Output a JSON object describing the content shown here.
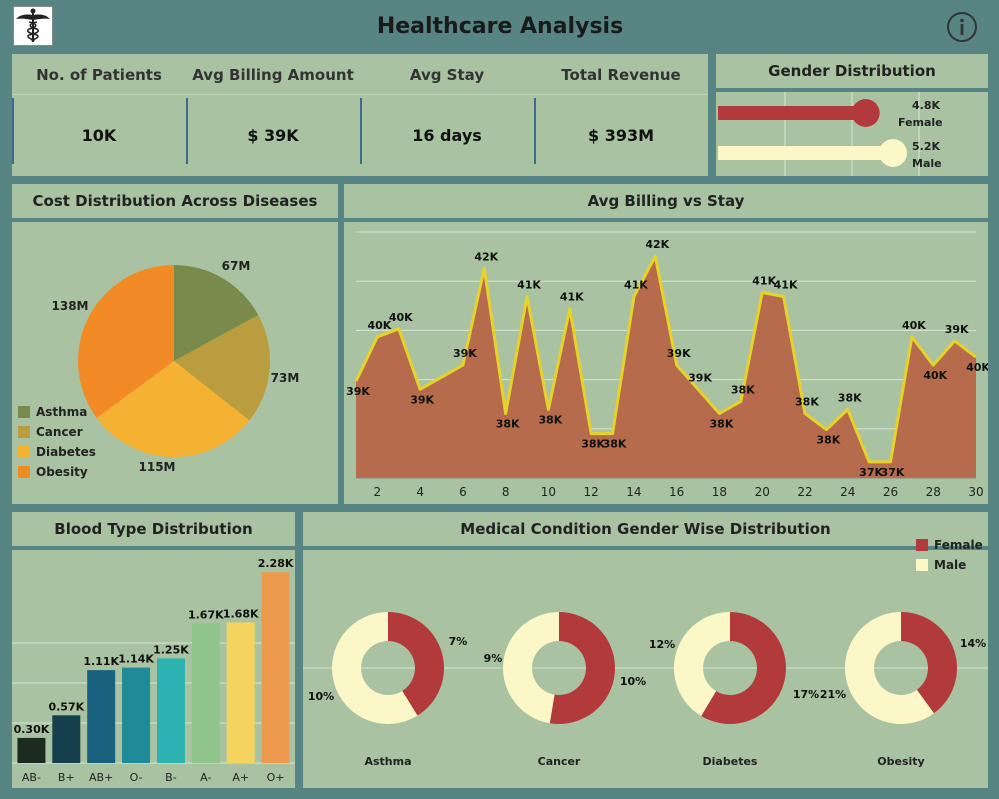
{
  "header": {
    "title": "Healthcare Analysis",
    "logo_icon": "caduceus-icon",
    "info_icon": "info-icon"
  },
  "kpis": [
    {
      "label": "No. of Patients",
      "value": "10K"
    },
    {
      "label": "Avg Billing Amount",
      "value": "$ 39K"
    },
    {
      "label": "Avg Stay",
      "value": "16 days"
    },
    {
      "label": "Total Revenue",
      "value": "$ 393M"
    }
  ],
  "gender": {
    "title": "Gender Distribution",
    "female": {
      "value_label": "4.8K",
      "name": "Female",
      "value": 4.8,
      "color": "#b23a3a"
    },
    "male": {
      "value_label": "5.2K",
      "name": "Male",
      "value": 5.2,
      "color": "#fbf7c6"
    }
  },
  "cost": {
    "title": "Cost Distribution Across Diseases",
    "legend": [
      "Asthma",
      "Cancer",
      "Diabetes",
      "Obesity"
    ]
  },
  "billing": {
    "title": "Avg Billing vs Stay"
  },
  "blood": {
    "title": "Blood Type Distribution"
  },
  "medical": {
    "title": "Medical Condition Gender Wise Distribution",
    "legend": [
      {
        "name": "Female",
        "color": "#b23a3a"
      },
      {
        "name": "Male",
        "color": "#fbf7c6"
      }
    ]
  },
  "chart_data": [
    {
      "type": "pie",
      "title": "Cost Distribution Across Diseases",
      "categories": [
        "Asthma",
        "Cancer",
        "Diabetes",
        "Obesity"
      ],
      "values": [
        67,
        73,
        115,
        138
      ],
      "labels": [
        "67M",
        "73M",
        "115M",
        "138M"
      ],
      "colors": [
        "#788a4c",
        "#b99d3e",
        "#f5b132",
        "#f28a25"
      ],
      "legend_position": "bottom-left"
    },
    {
      "type": "area",
      "title": "Avg Billing vs Stay",
      "x": [
        1,
        2,
        3,
        4,
        5,
        6,
        7,
        8,
        9,
        10,
        11,
        12,
        13,
        14,
        15,
        16,
        17,
        18,
        19,
        20,
        21,
        22,
        23,
        24,
        25,
        26,
        27,
        28,
        29,
        30
      ],
      "values": [
        39.2,
        40.3,
        40.5,
        39.0,
        39.3,
        39.6,
        42.0,
        38.4,
        41.3,
        38.5,
        41.0,
        37.9,
        37.9,
        41.3,
        42.3,
        39.6,
        39.0,
        38.4,
        38.7,
        41.4,
        41.3,
        38.4,
        38.0,
        38.5,
        37.2,
        37.2,
        40.3,
        39.6,
        40.2,
        39.8
      ],
      "labels": [
        "39K",
        "40K",
        "40K",
        "39K",
        "",
        "39K",
        "42K",
        "38K",
        "41K",
        "38K",
        "41K",
        "38K",
        "38K",
        "41K",
        "42K",
        "39K",
        "",
        "38K",
        "39K",
        "38K",
        "41K",
        "41K",
        "38K",
        "38K",
        "38K",
        "37K",
        "37K",
        "40K",
        "40K",
        "39K",
        "40K"
      ],
      "point_labels": [
        {
          "x": 1,
          "text": "39K"
        },
        {
          "x": 2,
          "text": "40K"
        },
        {
          "x": 3,
          "text": "40K"
        },
        {
          "x": 4,
          "text": "39K"
        },
        {
          "x": 6,
          "text": "39K"
        },
        {
          "x": 7,
          "text": "42K"
        },
        {
          "x": 8,
          "text": "38K"
        },
        {
          "x": 9,
          "text": "41K"
        },
        {
          "x": 10,
          "text": "38K"
        },
        {
          "x": 11,
          "text": "41K"
        },
        {
          "x": 12,
          "text": "38K"
        },
        {
          "x": 13,
          "text": "38K"
        },
        {
          "x": 14,
          "text": "41K"
        },
        {
          "x": 15,
          "text": "42K"
        },
        {
          "x": 16,
          "text": "39K"
        },
        {
          "x": 17,
          "text": "39K"
        },
        {
          "x": 18,
          "text": "38K"
        },
        {
          "x": 19,
          "text": "38K"
        },
        {
          "x": 20,
          "text": "41K"
        },
        {
          "x": 21,
          "text": "41K"
        },
        {
          "x": 22,
          "text": "38K"
        },
        {
          "x": 23,
          "text": "38K"
        },
        {
          "x": 24,
          "text": "38K"
        },
        {
          "x": 25,
          "text": "37K"
        },
        {
          "x": 26,
          "text": "37K"
        },
        {
          "x": 27,
          "text": "40K"
        },
        {
          "x": 28,
          "text": "40K"
        },
        {
          "x": 29,
          "text": "39K"
        },
        {
          "x": 30,
          "text": "40K"
        }
      ],
      "xticks": [
        2,
        4,
        6,
        8,
        10,
        12,
        14,
        16,
        18,
        20,
        22,
        24,
        26,
        28,
        30
      ],
      "ylim": [
        36.8,
        42.9
      ],
      "fill_color": "#b56b4c",
      "line_color": "#e6d22b",
      "grid": true
    },
    {
      "type": "bar",
      "title": "Blood Type Distribution",
      "categories": [
        "AB-",
        "B+",
        "AB+",
        "O-",
        "B-",
        "A-",
        "A+",
        "O+"
      ],
      "values": [
        0.3,
        0.57,
        1.11,
        1.14,
        1.25,
        1.67,
        1.68,
        2.28
      ],
      "labels": [
        "0.30K",
        "0.57K",
        "1.11K",
        "1.14K",
        "1.25K",
        "1.67K",
        "1.68K",
        "2.28K"
      ],
      "colors": [
        "#1d2a20",
        "#153f4c",
        "#18627f",
        "#1f8a98",
        "#2cb3b1",
        "#8fc58a",
        "#f4d35e",
        "#ee9a4e"
      ],
      "ylim": [
        0,
        2.45
      ]
    },
    {
      "type": "pie",
      "title": "Medical Condition Gender Wise Distribution",
      "categories": [
        "Asthma",
        "Cancer",
        "Diabetes",
        "Obesity"
      ],
      "series": [
        {
          "name": "Female",
          "values": [
            7,
            10,
            17,
            14
          ],
          "labels": [
            "7%",
            "10%",
            "17%",
            "14%"
          ]
        },
        {
          "name": "Male",
          "values": [
            10,
            9,
            12,
            21
          ],
          "labels": [
            "10%",
            "9%",
            "12%",
            "21%"
          ]
        }
      ]
    }
  ]
}
